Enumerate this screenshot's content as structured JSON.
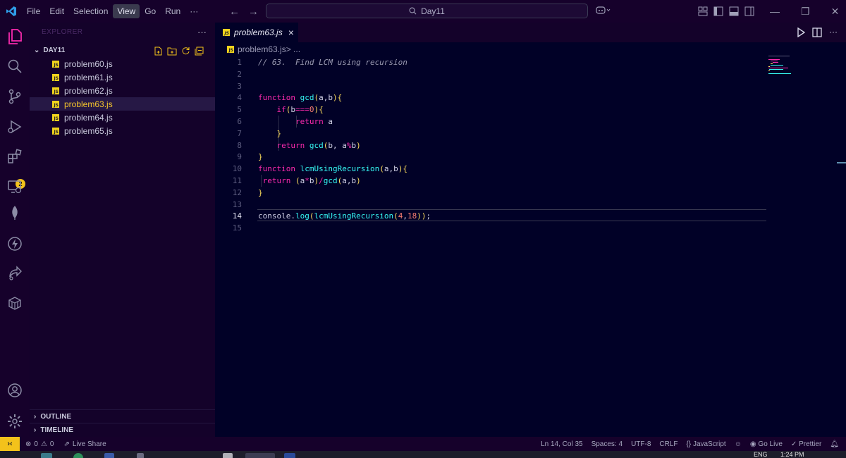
{
  "titlebar": {
    "menu": [
      "File",
      "Edit",
      "Selection",
      "View",
      "Go",
      "Run",
      "···"
    ],
    "active_menu": "View",
    "search": "Day11"
  },
  "activity": {
    "extensions_badge": "2"
  },
  "sidebar": {
    "title": "EXPLORER",
    "more": "···",
    "folder": "DAY11",
    "files": [
      "problem60.js",
      "problem61.js",
      "problem62.js",
      "problem63.js",
      "problem64.js",
      "problem65.js"
    ],
    "selected": "problem63.js",
    "outline": "OUTLINE",
    "timeline": "TIMELINE"
  },
  "editor": {
    "tab": "problem63.js",
    "tab_close": "×",
    "breadcrumb_file": "problem63.js",
    "breadcrumb_rest": " > ...",
    "js_badge": "JS",
    "current_line": 14,
    "lines": [
      {
        "n": "1",
        "t": "// 63.  Find LCM using recursion"
      },
      {
        "n": "2",
        "t": ""
      },
      {
        "n": "3",
        "t": ""
      },
      {
        "n": "4",
        "t": "function gcd(a,b){"
      },
      {
        "n": "5",
        "t": "    if(b===0){"
      },
      {
        "n": "6",
        "t": "        return a"
      },
      {
        "n": "7",
        "t": "    }"
      },
      {
        "n": "8",
        "t": "    return gcd(b, a%b)"
      },
      {
        "n": "9",
        "t": "}"
      },
      {
        "n": "10",
        "t": "function lcmUsingRecursion(a,b){"
      },
      {
        "n": "11",
        "t": " return (a*b)/gcd(a,b)"
      },
      {
        "n": "12",
        "t": "}"
      },
      {
        "n": "13",
        "t": ""
      },
      {
        "n": "14",
        "t": "console.log(lcmUsingRecursion(4,18));"
      },
      {
        "n": "15",
        "t": ""
      }
    ]
  },
  "statusbar": {
    "errors": "0",
    "warnings": "0",
    "live_share": "Live Share",
    "position": "Ln 14, Col 35",
    "spaces": "Spaces: 4",
    "encoding": "UTF-8",
    "eol": "CRLF",
    "language": "JavaScript",
    "go_live": "Go Live",
    "prettier": "Prettier"
  },
  "taskbar": {
    "lang": "ENG",
    "time": "1:24 PM"
  },
  "colors": {
    "background": "#010127",
    "keyword": "#f92aad",
    "function": "#36f9f6",
    "number": "#f97e72",
    "bracket": "#fede5d",
    "selected_file": "#f6c62c"
  }
}
